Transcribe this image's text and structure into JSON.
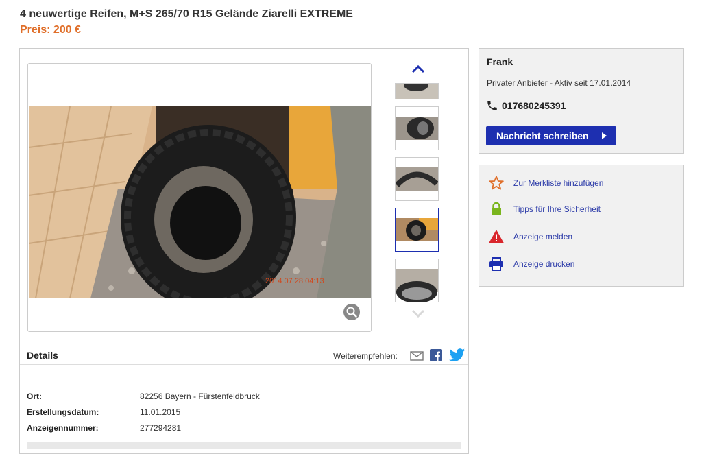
{
  "listing": {
    "title": "4 neuwertige Reifen, M+S 265/70 R15 Gelände Ziarelli EXTREME",
    "price": "Preis: 200 €"
  },
  "gallery": {
    "photo_timestamp": "2014 07 28 04:13"
  },
  "details": {
    "heading": "Details",
    "share_label": "Weiterempfehlen:",
    "rows": [
      {
        "key": "Ort:",
        "value": "82256 Bayern - Fürstenfeldbruck"
      },
      {
        "key": "Erstellungsdatum:",
        "value": "11.01.2015"
      },
      {
        "key": "Anzeigennummer:",
        "value": "277294281"
      }
    ]
  },
  "seller": {
    "name": "Frank",
    "subtitle": "Privater Anbieter - Aktiv seit 17.01.2014",
    "phone": "017680245391",
    "message_button": "Nachricht schreiben"
  },
  "actions": [
    {
      "label": "Zur Merkliste hinzufügen",
      "icon": "star-icon",
      "color": "#e06f2a"
    },
    {
      "label": "Tipps für Ihre Sicherheit",
      "icon": "lock-icon",
      "color": "#7ab51d"
    },
    {
      "label": "Anzeige melden",
      "icon": "warning-icon",
      "color": "#d9262c"
    },
    {
      "label": "Anzeige drucken",
      "icon": "printer-icon",
      "color": "#1d2fb0"
    }
  ],
  "colors": {
    "accent": "#1d2fb0",
    "price": "#e06f2a",
    "link": "#2b3aa8"
  }
}
